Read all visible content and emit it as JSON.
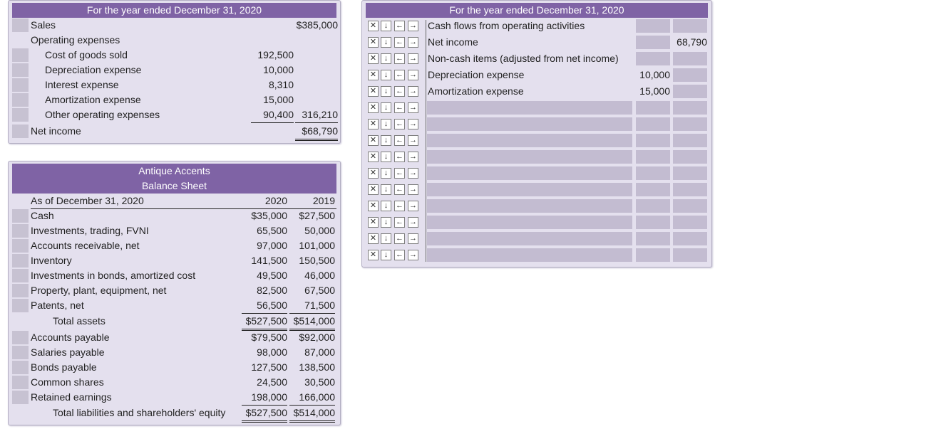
{
  "income_statement": {
    "header": "For the year ended December 31, 2020",
    "sales_label": "Sales",
    "sales_value": "$385,000",
    "opex_label": "Operating expenses",
    "expenses": [
      {
        "label": "Cost of goods sold",
        "value": "192,500"
      },
      {
        "label": "Depreciation expense",
        "value": "10,000"
      },
      {
        "label": "Interest expense",
        "value": "8,310"
      },
      {
        "label": "Amortization expense",
        "value": "15,000"
      },
      {
        "label": "Other operating expenses",
        "value": "90,400"
      }
    ],
    "total_expenses": "316,210",
    "net_income_label": "Net income",
    "net_income_value": "$68,790"
  },
  "balance_sheet": {
    "company": "Antique Accents",
    "title": "Balance Sheet",
    "as_of": "As of December 31, 2020",
    "col_2020": "2020",
    "col_2019": "2019",
    "assets": [
      {
        "label": "Cash",
        "v2020": "$35,000",
        "v2019": "$27,500"
      },
      {
        "label": "Investments, trading, FVNI",
        "v2020": "65,500",
        "v2019": "50,000"
      },
      {
        "label": "Accounts receivable, net",
        "v2020": "97,000",
        "v2019": "101,000"
      },
      {
        "label": "Inventory",
        "v2020": "141,500",
        "v2019": "150,500"
      },
      {
        "label": "Investments in bonds, amortized cost",
        "v2020": "49,500",
        "v2019": "46,000"
      },
      {
        "label": "Property, plant, equipment, net",
        "v2020": "82,500",
        "v2019": "67,500"
      },
      {
        "label": "Patents, net",
        "v2020": "56,500",
        "v2019": "71,500"
      }
    ],
    "total_assets_label": "Total assets",
    "total_assets_2020": "$527,500",
    "total_assets_2019": "$514,000",
    "liabilities": [
      {
        "label": "Accounts payable",
        "v2020": "$79,500",
        "v2019": "$92,000"
      },
      {
        "label": "Salaries payable",
        "v2020": "98,000",
        "v2019": "87,000"
      },
      {
        "label": "Bonds payable",
        "v2020": "127,500",
        "v2019": "138,500"
      },
      {
        "label": "Common shares",
        "v2020": "24,500",
        "v2019": "30,500"
      },
      {
        "label": "Retained earnings",
        "v2020": "198,000",
        "v2019": "166,000"
      }
    ],
    "total_le_label": "Total liabilities and shareholders' equity",
    "total_le_2020": "$527,500",
    "total_le_2019": "$514,000"
  },
  "cash_flow": {
    "header": "For the year ended December 31, 2020",
    "controls": {
      "delete": "✕",
      "down": "↓",
      "outdent": "←",
      "indent": "→"
    },
    "rows": [
      {
        "desc": "Cash flows from operating activities",
        "amt1": "",
        "amt2": ""
      },
      {
        "desc": "Net income",
        "amt1": "",
        "amt2": "68,790"
      },
      {
        "desc": "Non-cash items (adjusted from net income)",
        "amt1": "",
        "amt2": ""
      },
      {
        "desc": "Depreciation expense",
        "amt1": "10,000",
        "amt2": ""
      },
      {
        "desc": "Amortization expense",
        "amt1": "15,000",
        "amt2": ""
      },
      {
        "desc": "",
        "amt1": "",
        "amt2": ""
      },
      {
        "desc": "",
        "amt1": "",
        "amt2": ""
      },
      {
        "desc": "",
        "amt1": "",
        "amt2": ""
      },
      {
        "desc": "",
        "amt1": "",
        "amt2": ""
      },
      {
        "desc": "",
        "amt1": "",
        "amt2": ""
      },
      {
        "desc": "",
        "amt1": "",
        "amt2": ""
      },
      {
        "desc": "",
        "amt1": "",
        "amt2": ""
      },
      {
        "desc": "",
        "amt1": "",
        "amt2": ""
      },
      {
        "desc": "",
        "amt1": "",
        "amt2": ""
      },
      {
        "desc": "",
        "amt1": "",
        "amt2": ""
      }
    ]
  }
}
